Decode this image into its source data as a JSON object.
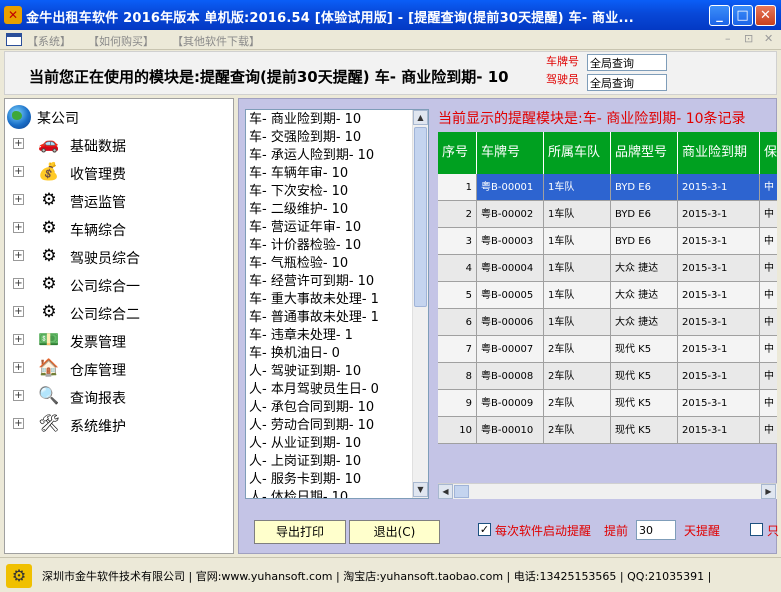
{
  "window": {
    "title": "金牛出租车软件 2016年版本 单机版:2016.54 [体验试用版] - [提醒查询(提前30天提醒) 车- 商业...",
    "app_icon": "taxi-app-icon",
    "minimize_glyph": "_",
    "maximize_glyph": "□",
    "close_glyph": "✕"
  },
  "menubar": {
    "items": [
      "【系统】",
      "【如何购买】",
      "【其他软件下载】"
    ],
    "mdi_controls": [
      "–",
      "⊡",
      "✕"
    ]
  },
  "header": {
    "module_text": "当前您正在使用的模块是:提醒查询(提前30天提醒) 车- 商业险到期- 10",
    "plate_label": "车牌号",
    "driver_label": "驾驶员",
    "plate_value": "全局查询",
    "driver_value": "全局查询"
  },
  "tree": {
    "root": "某公司",
    "items": [
      {
        "label": "基础数据",
        "icon": "car-icon",
        "glyph": "🚗"
      },
      {
        "label": "收管理费",
        "icon": "money-icon",
        "glyph": "💰"
      },
      {
        "label": "营运监管",
        "icon": "gears-icon",
        "glyph": "⚙"
      },
      {
        "label": "车辆综合",
        "icon": "gears-icon",
        "glyph": "⚙"
      },
      {
        "label": "驾驶员综合",
        "icon": "gears-icon",
        "glyph": "⚙"
      },
      {
        "label": "公司综合一",
        "icon": "gears-icon",
        "glyph": "⚙"
      },
      {
        "label": "公司综合二",
        "icon": "gears-icon",
        "glyph": "⚙"
      },
      {
        "label": "发票管理",
        "icon": "cash-icon",
        "glyph": "💵"
      },
      {
        "label": "仓库管理",
        "icon": "house-icon",
        "glyph": "🏠"
      },
      {
        "label": "查询报表",
        "icon": "magnifier-icon",
        "glyph": "🔍"
      },
      {
        "label": "系统维护",
        "icon": "tools-icon",
        "glyph": "🛠"
      }
    ]
  },
  "modules": [
    "车- 商业险到期- 10",
    "车- 交强险到期- 10",
    "车- 承运人险到期- 10",
    "车- 车辆年审- 10",
    "车- 下次安检- 10",
    "车- 二级维护- 10",
    "车- 营运证年审- 10",
    "车- 计价器检验- 10",
    "车- 气瓶检验- 10",
    "车- 经营许可到期- 10",
    "车- 重大事故未处理- 1",
    "车- 普通事故未处理- 1",
    "车- 违章未处理- 1",
    "车- 换机油日- 0",
    "人- 驾驶证到期- 10",
    "人- 本月驾驶员生日- 0",
    "人- 承包合同到期- 10",
    "人- 劳动合同到期- 10",
    "人- 从业证到期- 10",
    "人- 上岗证到期- 10",
    "人- 服务卡到期- 10",
    "人- 体检日期- 10"
  ],
  "reminder": "当前显示的提醒模块是:车- 商业险到期- 10条记录",
  "table": {
    "columns": [
      "序号",
      "车牌号",
      "所属车队",
      "品牌型号",
      "商业险到期",
      "保"
    ],
    "rows": [
      [
        "1",
        "粤B-00001",
        "1车队",
        "BYD E6",
        "2015-3-1",
        "中"
      ],
      [
        "2",
        "粤B-00002",
        "1车队",
        "BYD E6",
        "2015-3-1",
        "中"
      ],
      [
        "3",
        "粤B-00003",
        "1车队",
        "BYD E6",
        "2015-3-1",
        "中"
      ],
      [
        "4",
        "粤B-00004",
        "1车队",
        "大众 捷达",
        "2015-3-1",
        "中"
      ],
      [
        "5",
        "粤B-00005",
        "1车队",
        "大众 捷达",
        "2015-3-1",
        "中"
      ],
      [
        "6",
        "粤B-00006",
        "1车队",
        "大众 捷达",
        "2015-3-1",
        "中"
      ],
      [
        "7",
        "粤B-00007",
        "2车队",
        "现代 K5",
        "2015-3-1",
        "中"
      ],
      [
        "8",
        "粤B-00008",
        "2车队",
        "现代 K5",
        "2015-3-1",
        "中"
      ],
      [
        "9",
        "粤B-00009",
        "2车队",
        "现代 K5",
        "2015-3-1",
        "中"
      ],
      [
        "10",
        "粤B-00010",
        "2车队",
        "现代 K5",
        "2015-3-1",
        "中"
      ]
    ],
    "selected_row": 0
  },
  "controls": {
    "export_button": "导出打印",
    "exit_button": "退出(C)",
    "startup_reminder_label": "每次软件启动提醒",
    "startup_checked": true,
    "advance_label": "提前",
    "advance_days": "30",
    "days_label": "天提醒",
    "only_label": "只"
  },
  "status": {
    "text": "深圳市金牛软件技术有限公司 | 官网:www.yuhansoft.com | 淘宝店:yuhansoft.taobao.com | 电话:13425153565 | QQ:21035391 |"
  },
  "colors": {
    "titlebar": "#0848d8",
    "header_green": "#00a020",
    "selected_row": "#2d64d0",
    "reminder_red": "#e00000",
    "panel_bg": "#c4c4e6",
    "button_bg": "#ffffcc"
  }
}
